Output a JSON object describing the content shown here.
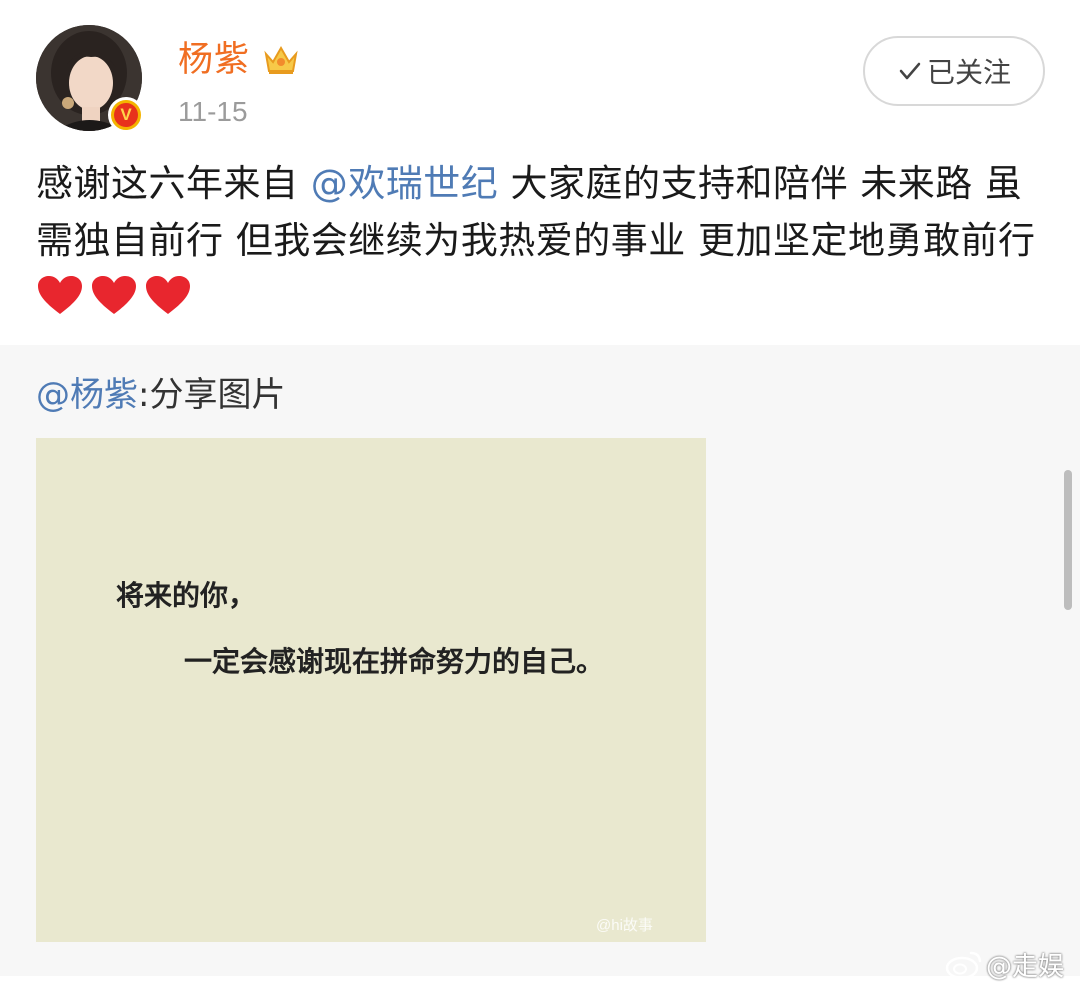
{
  "post": {
    "username": "杨紫",
    "date": "11-15",
    "follow_label": "已关注",
    "verify_mark": "V",
    "text_parts": {
      "before": "感谢这六年来自 ",
      "mention": "@欢瑞世纪",
      "after": " 大家庭的支持和陪伴 未来路 虽需独自前行 但我会继续为我热爱的事业 更加坚定地勇敢前行"
    },
    "heart_count": 3
  },
  "repost": {
    "mention": "@杨紫",
    "text": ":分享图片",
    "image": {
      "line1": "将来的你，",
      "line2": "一定会感谢现在拼命努力的自己。",
      "watermark": "@hi故事"
    }
  },
  "footer": {
    "watermark": "@走娱"
  },
  "colors": {
    "username": "#f06e22",
    "mention": "#4f7bb5",
    "repost_background": "#f7f7f7",
    "image_background": "#e9e8cf"
  }
}
